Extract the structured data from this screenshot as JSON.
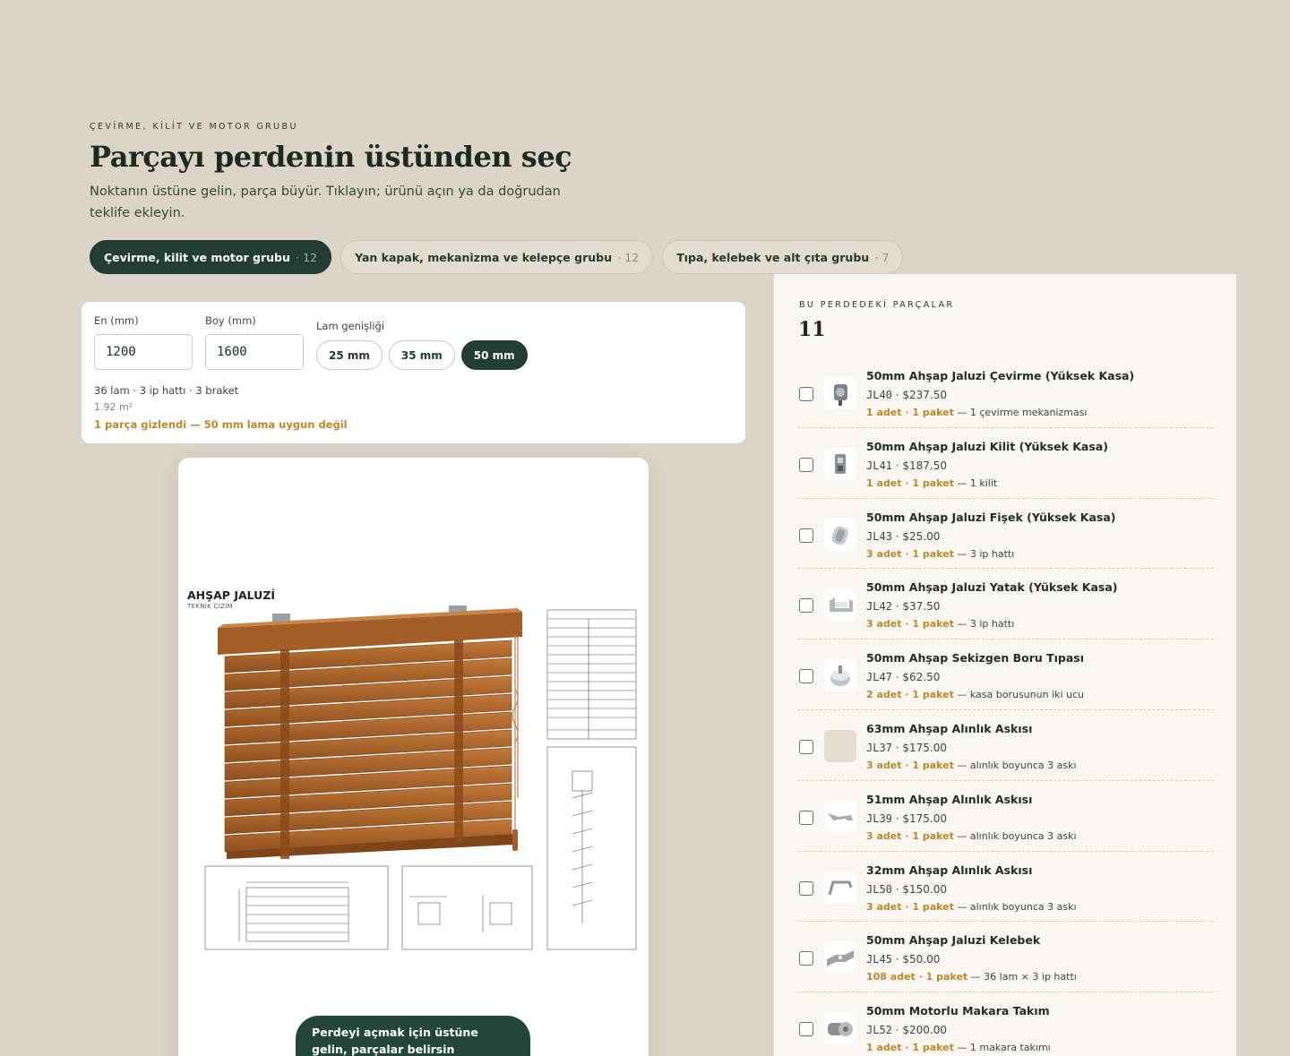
{
  "header": {
    "eyebrow": "ÇEVİRME, KİLİT VE MOTOR GRUBU",
    "title": "Parçayı perdenin üstünden seç",
    "subtitle": "Noktanın üstüne gelin, parça büyür. Tıklayın; ürünü açın ya da doğrudan teklife ekleyin."
  },
  "tabs": [
    {
      "label": "Çevirme, kilit ve motor grubu",
      "count": "· 12",
      "active": true
    },
    {
      "label": "Yan kapak, mekanizma ve kelepçe grubu",
      "count": "· 12",
      "active": false
    },
    {
      "label": "Tıpa, kelebek ve alt çıta grubu",
      "count": "· 7",
      "active": false
    }
  ],
  "config": {
    "width_label": "En (mm)",
    "width_value": "1200",
    "height_label": "Boy (mm)",
    "height_value": "1600",
    "lam_label": "Lam genişliği",
    "lam_options": [
      "25 mm",
      "35 mm",
      "50 mm"
    ],
    "lam_selected": "50 mm",
    "summary": "36 lam · 3 ip hattı · 3 braket",
    "area": "1.92 m²",
    "warning": "1 parça gizlendi — 50 mm lama uygun değil"
  },
  "drawing": {
    "title": "AHŞAP JALUZİ",
    "subtitle": "TEKNİK ÇİZİM",
    "hint": "Perdeyi açmak için üstüne gelin, parçalar belirsin"
  },
  "panel": {
    "eyebrow": "BU PERDEDEKİ PARÇALAR",
    "count": "11",
    "parts": [
      {
        "name": "50mm Ahşap Jaluzi Çevirme (Yüksek Kasa)",
        "code": "JL40",
        "price": "$237.50",
        "qty": "1 adet · 1 paket",
        "note": "— 1 çevirme mekanizması",
        "icon": "crank-mechanism-icon"
      },
      {
        "name": "50mm Ahşap Jaluzi Kilit (Yüksek Kasa)",
        "code": "JL41",
        "price": "$187.50",
        "qty": "1 adet · 1 paket",
        "note": "— 1 kilit",
        "icon": "cord-lock-icon"
      },
      {
        "name": "50mm Ahşap Jaluzi Fişek (Yüksek Kasa)",
        "code": "JL43",
        "price": "$25.00",
        "qty": "3 adet · 1 paket",
        "note": "— 3 ip hattı",
        "icon": "spool-icon"
      },
      {
        "name": "50mm Ahşap Jaluzi Yatak (Yüksek Kasa)",
        "code": "JL42",
        "price": "$37.50",
        "qty": "3 adet · 1 paket",
        "note": "— 3 ip hattı",
        "icon": "cradle-icon"
      },
      {
        "name": "50mm Ahşap Sekizgen Boru Tıpası",
        "code": "JL47",
        "price": "$62.50",
        "qty": "2 adet · 1 paket",
        "note": "— kasa borusunun iki ucu",
        "icon": "end-cap-icon"
      },
      {
        "name": "63mm Ahşap Alınlık Askısı",
        "code": "JL37",
        "price": "$175.00",
        "qty": "3 adet · 1 paket",
        "note": "— alınlık boyunca 3 askı",
        "icon": "placeholder-icon"
      },
      {
        "name": "51mm Ahşap Alınlık Askısı",
        "code": "JL39",
        "price": "$175.00",
        "qty": "3 adet · 1 paket",
        "note": "— alınlık boyunca 3 askı",
        "icon": "clip-icon"
      },
      {
        "name": "32mm Ahşap Alınlık Askısı",
        "code": "JL50",
        "price": "$150.00",
        "qty": "3 adet · 1 paket",
        "note": "— alınlık boyunca 3 askı",
        "icon": "hook-icon"
      },
      {
        "name": "50mm Ahşap Jaluzi Kelebek",
        "code": "JL45",
        "price": "$50.00",
        "qty": "108 adet · 1 paket",
        "note": "— 36 lam × 3 ip hattı",
        "icon": "butterfly-icon"
      },
      {
        "name": "50mm Motorlu Makara Takım",
        "code": "JL52",
        "price": "$200.00",
        "qty": "1 adet · 1 paket",
        "note": "— 1 makara takımı",
        "icon": "pulley-icon"
      }
    ]
  }
}
